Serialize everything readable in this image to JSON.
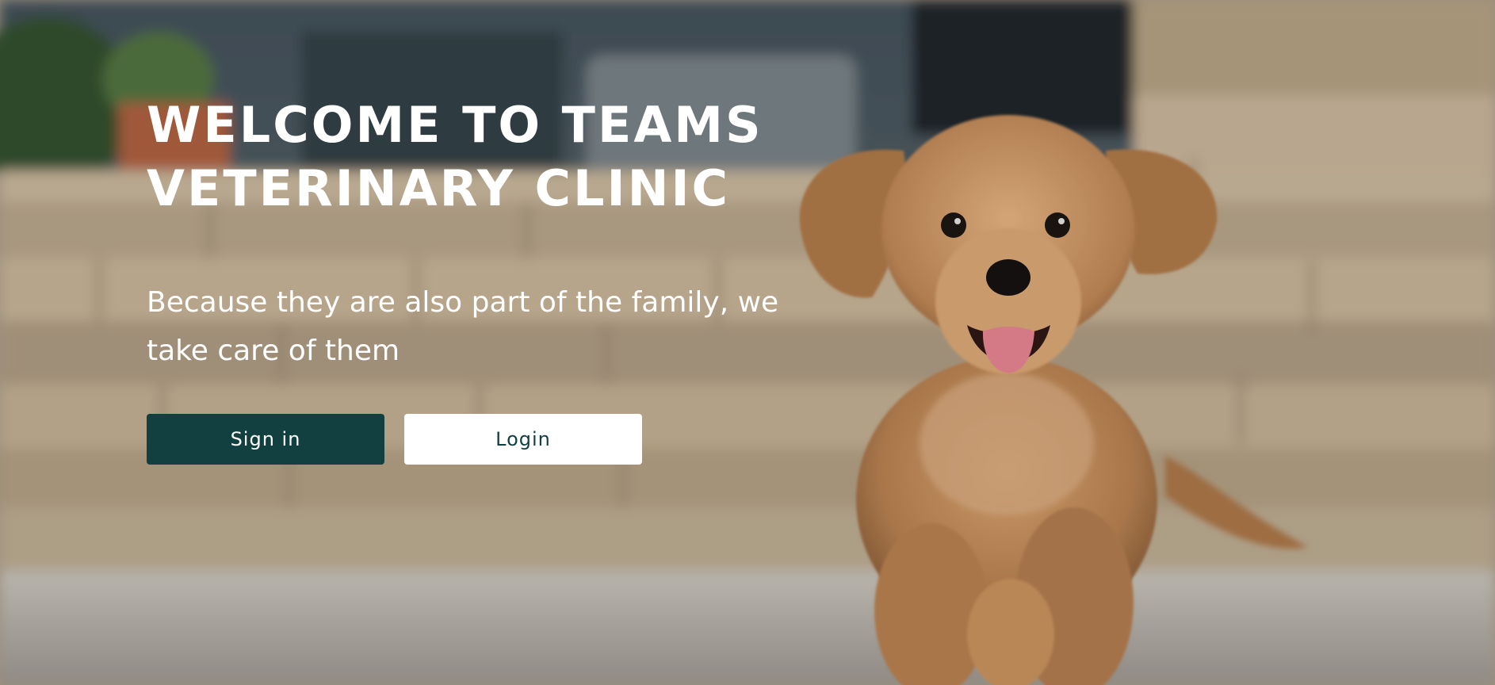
{
  "hero": {
    "title_line1": "WELCOME TO TEAMS",
    "title_line2": "VETERINARY CLINIC",
    "subtitle": "Because they are also part of the family, we take care of them",
    "background_image": "puppy-running-on-stone-patio",
    "buttons": {
      "sign_in_label": "Sign in",
      "login_label": "Login"
    }
  },
  "colors": {
    "primary": "#123f3f",
    "button_secondary_bg": "#ffffff",
    "text_on_image": "#ffffff"
  }
}
